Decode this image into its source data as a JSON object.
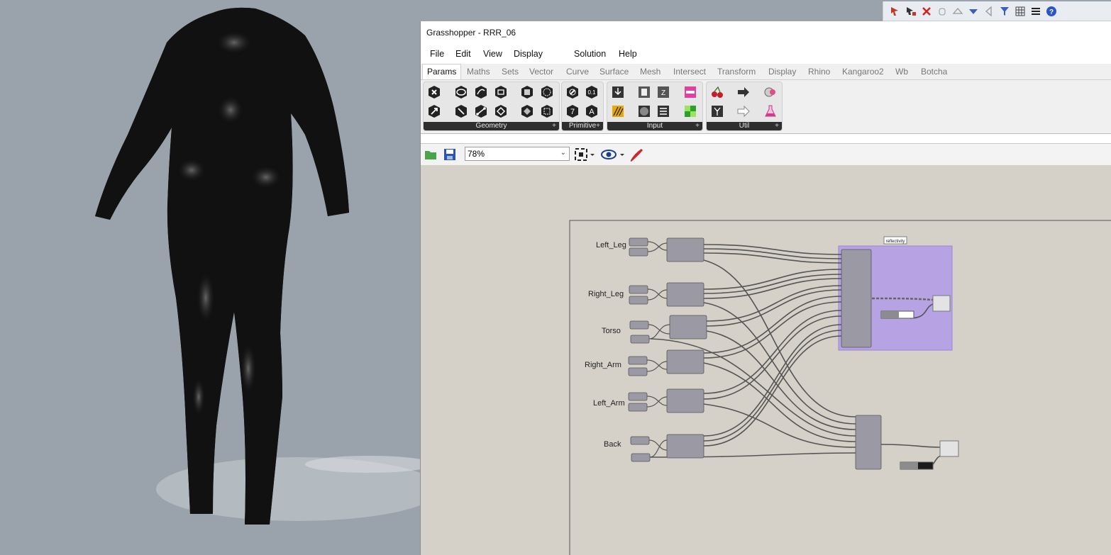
{
  "window": {
    "title": "Grasshopper - RRR_06"
  },
  "menu": [
    "File",
    "Edit",
    "View",
    "Display",
    "Solution",
    "Help"
  ],
  "tabs": [
    "Params",
    "Maths",
    "Sets",
    "Vector",
    "Curve",
    "Surface",
    "Mesh",
    "Intersect",
    "Transform",
    "Display",
    "Rhino",
    "Kangaroo2",
    "Wb",
    "Botcha"
  ],
  "active_tab": "Params",
  "panels": [
    "Geometry",
    "Primitive",
    "Input",
    "Util"
  ],
  "panel_expand": "+",
  "canvas_toolbar": {
    "zoom": "78%",
    "zoom_dropdown": "⌄"
  },
  "groups": [
    "Left_Leg",
    "Right_Leg",
    "Torso",
    "Right_Arm",
    "Left_Arm",
    "Back"
  ],
  "group_tag": "reflectivity",
  "rhino_toolbar_icons": [
    "select-cursor-icon",
    "select-filter-icon",
    "delete-x-icon",
    "hand-icon",
    "arrow-up-icon",
    "arrow-down-icon",
    "arrow-left-icon",
    "filter-icon",
    "grid-icon",
    "menu-icon",
    "help-icon"
  ],
  "colors": {
    "canvas": "#d5d1c9",
    "group": "#b7a3e3",
    "node": "#9a99a4",
    "viewport": "#9aa3ab"
  }
}
